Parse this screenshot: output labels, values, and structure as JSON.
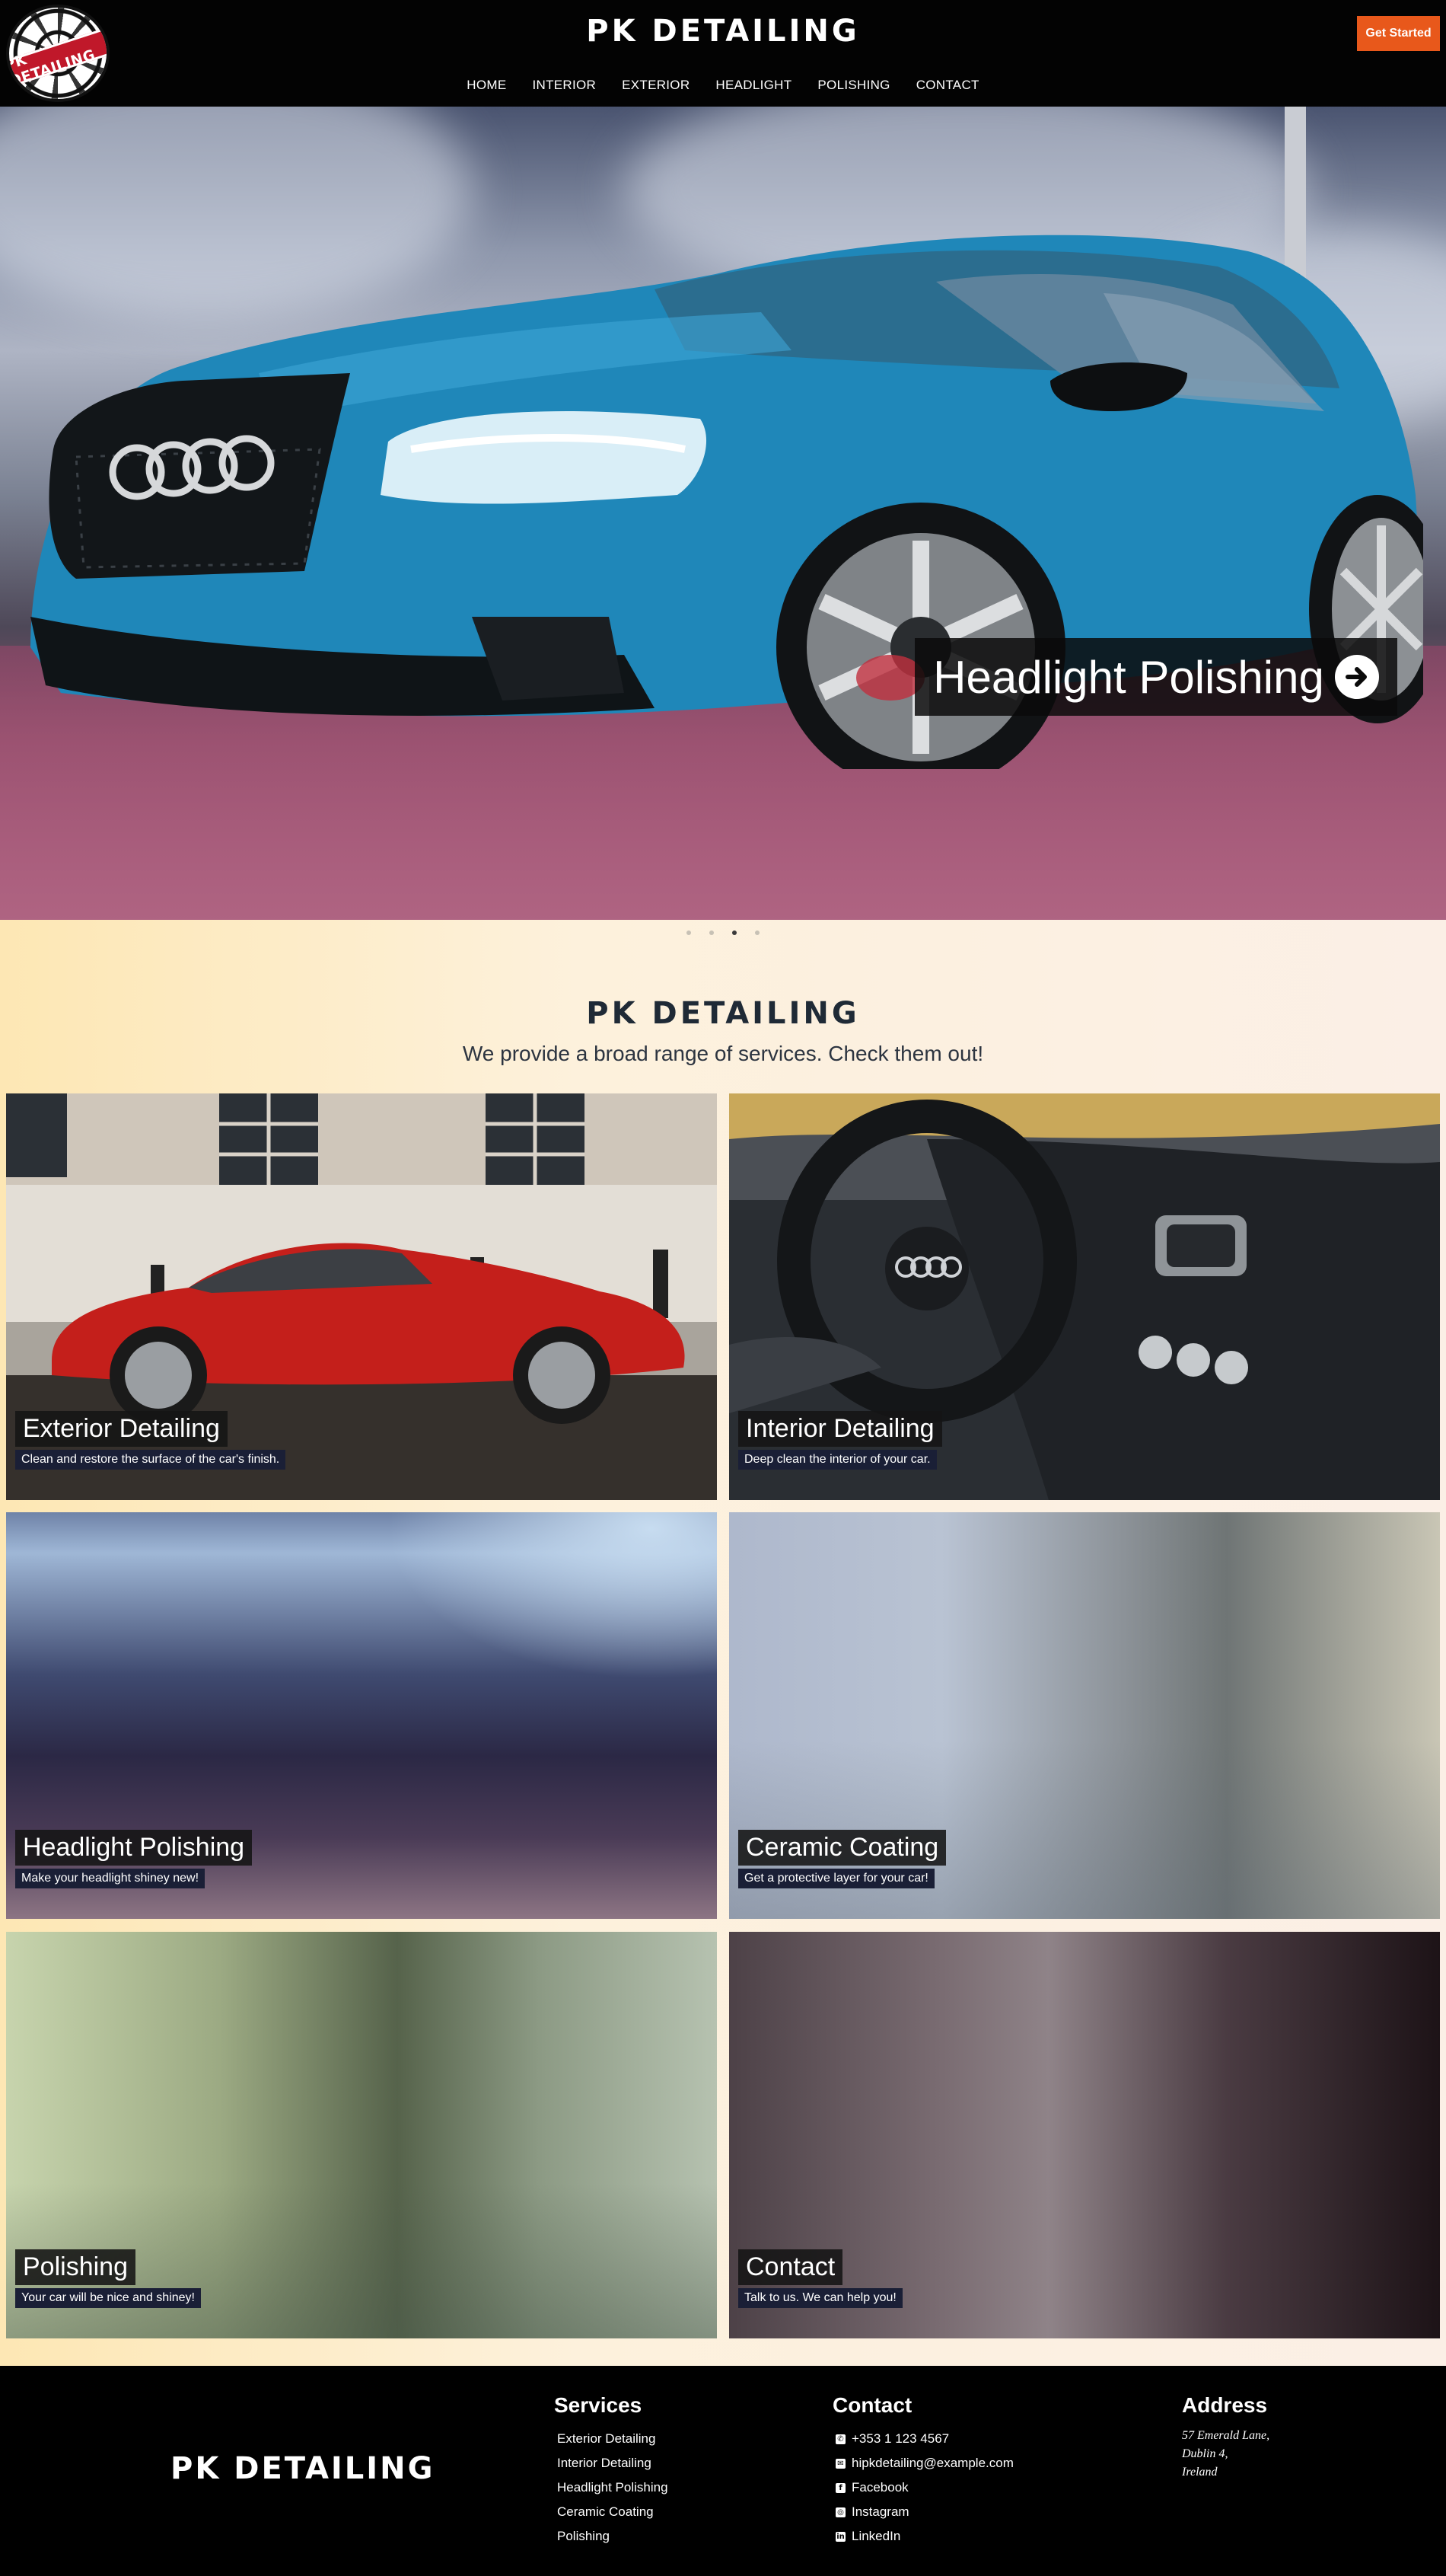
{
  "header": {
    "logo_text": "PK DETAILING",
    "title": "PK DETAILING",
    "cta_label": "Get Started",
    "nav": [
      {
        "label": "HOME"
      },
      {
        "label": "INTERIOR"
      },
      {
        "label": "EXTERIOR"
      },
      {
        "label": "HEADLIGHT"
      },
      {
        "label": "POLISHING"
      },
      {
        "label": "CONTACT"
      }
    ]
  },
  "hero": {
    "caption": "Headlight Polishing",
    "slide_count": 4,
    "active_slide": 3
  },
  "services": {
    "title": "PK DETAILING",
    "subtitle": "We provide a broad range of services. Check them out!",
    "cards": [
      {
        "title": "Exterior Detailing",
        "description": "Clean and restore the surface of the car's finish."
      },
      {
        "title": "Interior Detailing",
        "description": "Deep clean the interior of your car."
      },
      {
        "title": "Headlight Polishing",
        "description": "Make your headlight shiney new!"
      },
      {
        "title": "Ceramic Coating",
        "description": "Get a protective layer for your car!"
      },
      {
        "title": "Polishing",
        "description": "Your car will be nice and shiney!"
      },
      {
        "title": "Contact",
        "description": "Talk to us. We can help you!"
      }
    ]
  },
  "footer": {
    "brand": "PK DETAILING",
    "services": {
      "heading": "Services",
      "items": [
        "Exterior Detailing",
        "Interior Detailing",
        "Headlight Polishing",
        "Ceramic Coating",
        "Polishing"
      ]
    },
    "contact": {
      "heading": "Contact",
      "items": [
        {
          "icon": "phone-icon",
          "label": "+353 1 123 4567"
        },
        {
          "icon": "mail-icon",
          "label": "hipkdetailing@example.com"
        },
        {
          "icon": "facebook-icon",
          "label": "Facebook"
        },
        {
          "icon": "instagram-icon",
          "label": "Instagram"
        },
        {
          "icon": "linkedin-icon",
          "label": "LinkedIn"
        }
      ]
    },
    "address": {
      "heading": "Address",
      "lines": [
        "57 Emerald Lane,",
        "Dublin 4,",
        "Ireland"
      ]
    }
  },
  "colors": {
    "header_bg": "#030303",
    "accent": "#e8581b",
    "card_desc_bg": "#1a1f36"
  }
}
